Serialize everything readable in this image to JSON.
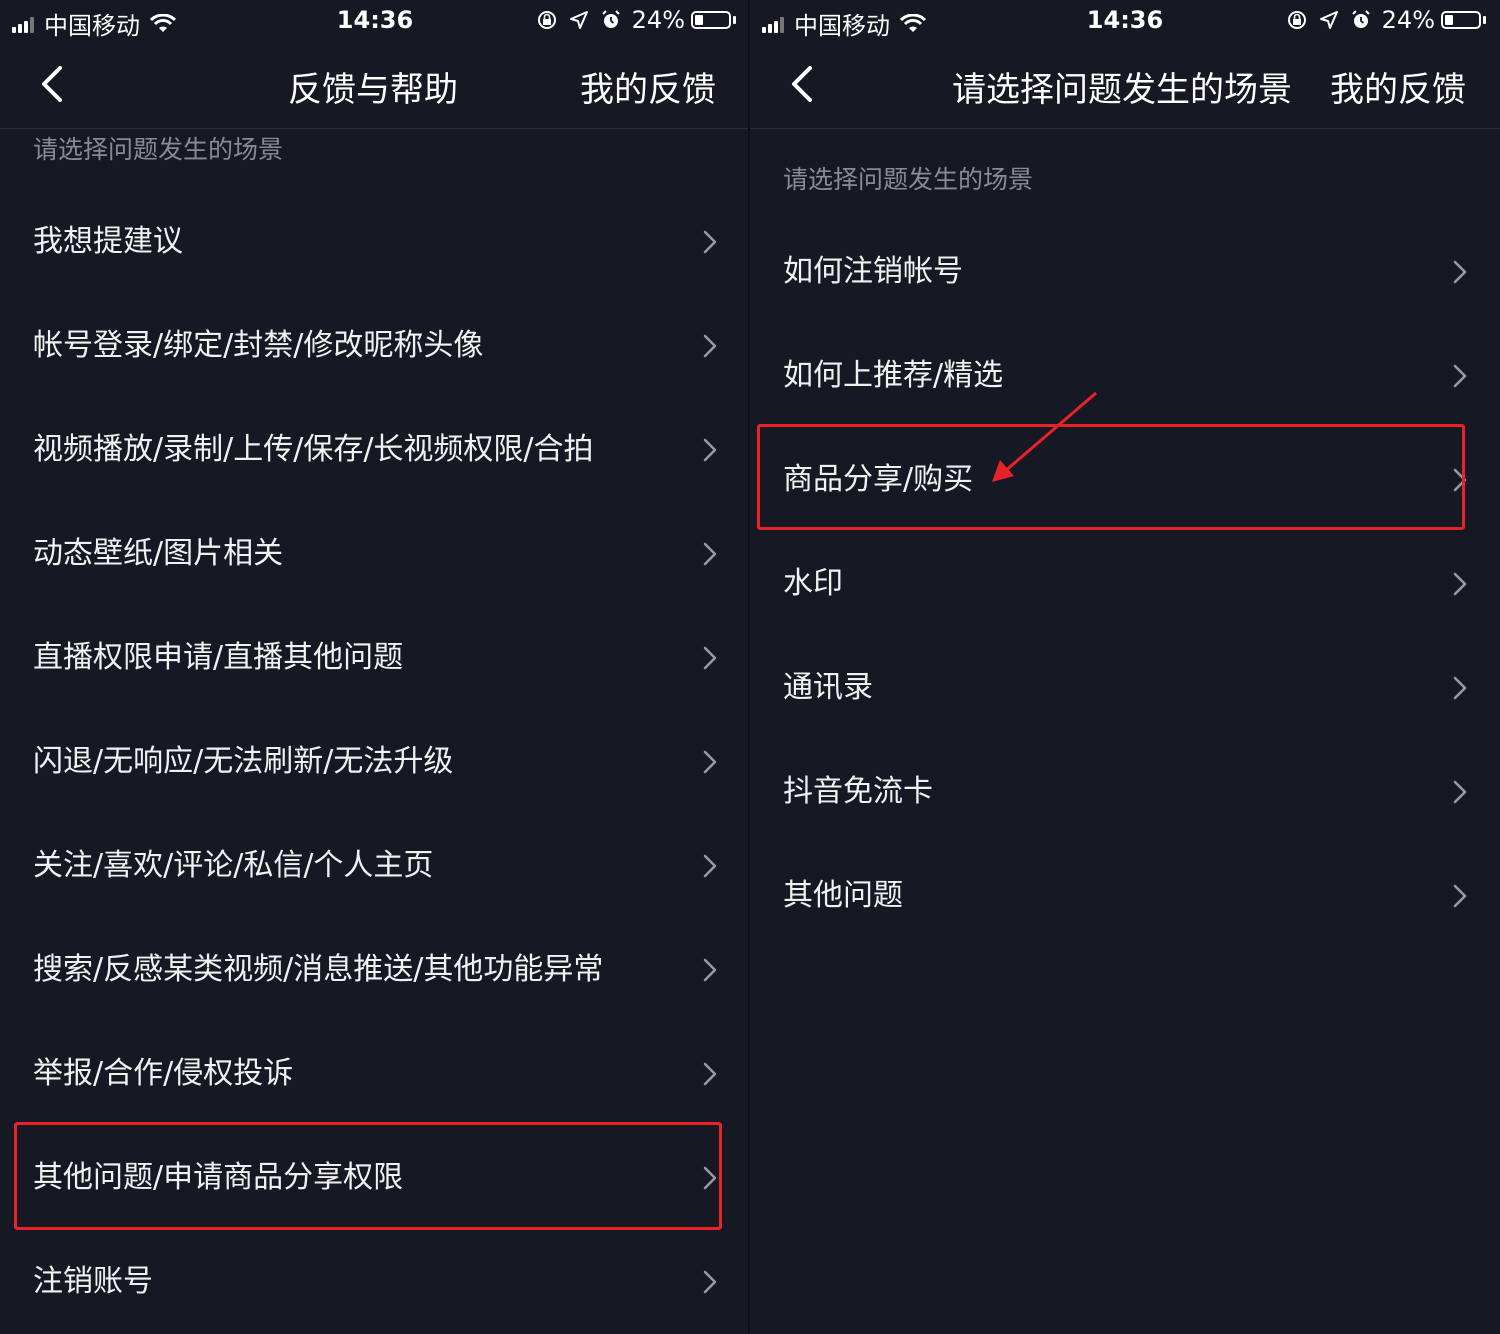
{
  "colors": {
    "background": "#161823",
    "highlight": "#e82227",
    "hint_text": "#8a8b91"
  },
  "left": {
    "status_bar": {
      "carrier": "中国移动",
      "time": "14:36",
      "battery": "24%"
    },
    "nav": {
      "title": "反馈与帮助",
      "action": "我的反馈"
    },
    "section_hint": "请选择问题发生的场景",
    "items": [
      {
        "label": "我想提建议"
      },
      {
        "label": "帐号登录/绑定/封禁/修改昵称头像"
      },
      {
        "label": "视频播放/录制/上传/保存/长视频权限/合拍"
      },
      {
        "label": "动态壁纸/图片相关"
      },
      {
        "label": "直播权限申请/直播其他问题"
      },
      {
        "label": "闪退/无响应/无法刷新/无法升级"
      },
      {
        "label": "关注/喜欢/评论/私信/个人主页"
      },
      {
        "label": "搜索/反感某类视频/消息推送/其他功能异常"
      },
      {
        "label": "举报/合作/侵权投诉"
      },
      {
        "label": "其他问题/申请商品分享权限",
        "highlighted": true
      },
      {
        "label": "注销账号"
      }
    ]
  },
  "right": {
    "status_bar": {
      "carrier": "中国移动",
      "time": "14:36",
      "battery": "24%"
    },
    "nav": {
      "title": "请选择问题发生的场景",
      "action": "我的反馈"
    },
    "section_hint": "请选择问题发生的场景",
    "items": [
      {
        "label": "如何注销帐号"
      },
      {
        "label": "如何上推荐/精选"
      },
      {
        "label": "商品分享/购买",
        "highlighted": true
      },
      {
        "label": "水印"
      },
      {
        "label": "通讯录"
      },
      {
        "label": "抖音免流卡"
      },
      {
        "label": "其他问题"
      }
    ]
  },
  "icons": {
    "back": "chevron-left-icon",
    "row": "chevron-right-icon",
    "wifi": "wifi-icon",
    "lock_rotation": "orientation-lock-icon",
    "location": "location-arrow-icon",
    "alarm": "alarm-icon"
  }
}
